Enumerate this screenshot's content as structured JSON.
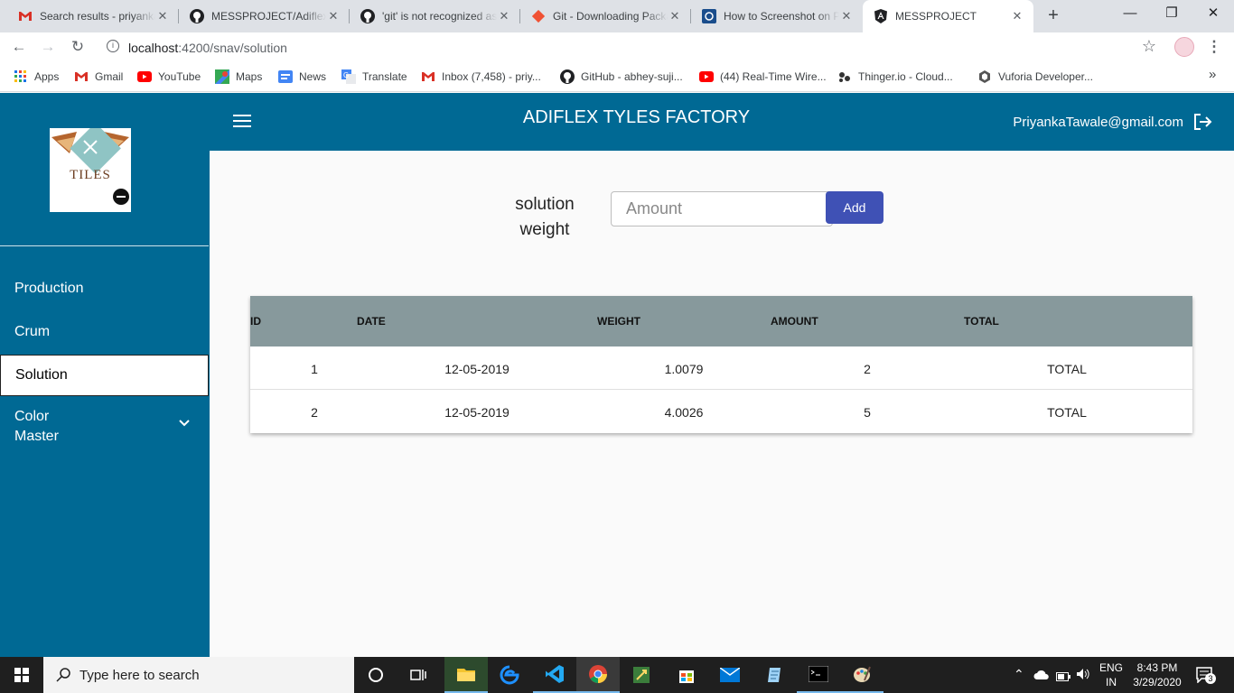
{
  "browser": {
    "tabs": [
      {
        "title": "Search results - priyanka",
        "icon": "gmail-icon",
        "close": "✕"
      },
      {
        "title": "MESSPROJECT/Adiflex.md",
        "icon": "github-icon",
        "close": "✕"
      },
      {
        "title": "'git' is not recognized as",
        "icon": "github-icon",
        "close": "✕"
      },
      {
        "title": "Git - Downloading Package",
        "icon": "git-icon",
        "close": "✕"
      },
      {
        "title": "How to Screenshot on PC",
        "icon": "site-icon",
        "close": "✕"
      },
      {
        "title": "MESSPROJECT",
        "icon": "angular-icon",
        "close": "✕"
      }
    ],
    "new_tab": "+",
    "url_host": "localhost",
    "url_rest": ":4200/snav/solution",
    "bookmarks": [
      {
        "label": "Apps",
        "icon": "apps-icon"
      },
      {
        "label": "Gmail",
        "icon": "gmail-icon"
      },
      {
        "label": "YouTube",
        "icon": "youtube-icon"
      },
      {
        "label": "Maps",
        "icon": "maps-icon"
      },
      {
        "label": "News",
        "icon": "news-icon"
      },
      {
        "label": "Translate",
        "icon": "translate-icon"
      },
      {
        "label": "Inbox (7,458) - priy...",
        "icon": "gmail-icon"
      },
      {
        "label": "GitHub - abhey-suji...",
        "icon": "github-icon"
      },
      {
        "label": "(44) Real-Time Wire...",
        "icon": "youtube-icon"
      },
      {
        "label": "Thinger.io - Cloud...",
        "icon": "thinger-icon"
      },
      {
        "label": "Vuforia Developer...",
        "icon": "vuforia-icon"
      }
    ],
    "more": "»"
  },
  "app": {
    "title": "ADIFLEX TYLES FACTORY",
    "user": "PriyankaTawale@gmail.com",
    "logo_text": "TILES",
    "nav": [
      {
        "label": "Production"
      },
      {
        "label": "Crum"
      },
      {
        "label": "Solution"
      },
      {
        "label": "Color Master"
      }
    ],
    "form": {
      "label": "solution weight",
      "placeholder": "Amount",
      "value": "",
      "add_label": "Add"
    },
    "table": {
      "headers": [
        "ID",
        "DATE",
        "WEIGHT",
        "AMOUNT",
        "TOTAL"
      ],
      "rows": [
        {
          "id": "1",
          "date": "12-05-2019",
          "weight": "1.0079",
          "amount": "2",
          "total": "TOTAL"
        },
        {
          "id": "2",
          "date": "12-05-2019",
          "weight": "4.0026",
          "amount": "5",
          "total": "TOTAL"
        }
      ]
    }
  },
  "taskbar": {
    "search_placeholder": "Type here to search",
    "lang1": "ENG",
    "lang2": "IN",
    "time": "8:43 PM",
    "date": "3/29/2020",
    "notifications": "3"
  },
  "colors": {
    "sidenav": "#006994",
    "toolbar": "#006994",
    "add_button": "#3f51b5",
    "table_header": "#87999c"
  }
}
